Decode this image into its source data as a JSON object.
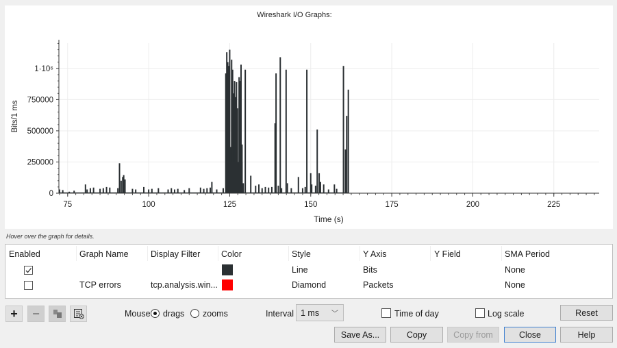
{
  "chart_data": {
    "type": "bar",
    "title": "Wireshark I/O Graphs:",
    "xlabel": "Time (s)",
    "ylabel": "Bits/1 ms",
    "xlim": [
      72.3,
      239
    ],
    "ylim": [
      0,
      1230000
    ],
    "x_ticks": [
      75,
      100,
      125,
      150,
      175,
      200,
      225
    ],
    "x_tick_labels": [
      "75",
      "100",
      "125",
      "150",
      "175",
      "200",
      "225"
    ],
    "y_ticks": [
      0,
      250000,
      500000,
      750000,
      1000000
    ],
    "y_tick_labels": [
      "0",
      "250000",
      "500000",
      "750000",
      "1·10⁶"
    ],
    "grid": true,
    "series": [
      {
        "name": "",
        "color": "#2b3033",
        "spikes": [
          [
            72.5,
            30000
          ],
          [
            73.5,
            25000
          ],
          [
            75.5,
            12000
          ],
          [
            77,
            20000
          ],
          [
            80.5,
            70000
          ],
          [
            81,
            30000
          ],
          [
            82,
            40000
          ],
          [
            83,
            45000
          ],
          [
            85,
            35000
          ],
          [
            86,
            40000
          ],
          [
            87,
            50000
          ],
          [
            88,
            45000
          ],
          [
            90.5,
            40000
          ],
          [
            91,
            240000
          ],
          [
            91.5,
            100000
          ],
          [
            92,
            130000
          ],
          [
            92.3,
            145000
          ],
          [
            92.7,
            110000
          ],
          [
            95,
            35000
          ],
          [
            96,
            30000
          ],
          [
            98.5,
            50000
          ],
          [
            100,
            30000
          ],
          [
            101,
            35000
          ],
          [
            103,
            40000
          ],
          [
            106,
            30000
          ],
          [
            107,
            40000
          ],
          [
            108,
            30000
          ],
          [
            109,
            35000
          ],
          [
            111,
            25000
          ],
          [
            112.5,
            40000
          ],
          [
            116,
            45000
          ],
          [
            117,
            35000
          ],
          [
            118,
            40000
          ],
          [
            119,
            45000
          ],
          [
            119.5,
            90000
          ],
          [
            121,
            30000
          ],
          [
            123,
            40000
          ],
          [
            123.8,
            960000
          ],
          [
            124.1,
            1130000
          ],
          [
            124.4,
            1050000
          ],
          [
            124.7,
            1020000
          ],
          [
            125,
            1150000
          ],
          [
            125.3,
            370000
          ],
          [
            125.6,
            1070000
          ],
          [
            125.9,
            990000
          ],
          [
            126.2,
            800000
          ],
          [
            126.5,
            900000
          ],
          [
            126.8,
            770000
          ],
          [
            127.1,
            890000
          ],
          [
            127.4,
            680000
          ],
          [
            127.7,
            170000
          ],
          [
            127.9,
            930000
          ],
          [
            128.2,
            900000
          ],
          [
            128.5,
            1030000
          ],
          [
            128.8,
            390000
          ],
          [
            129.2,
            80000
          ],
          [
            129.8,
            990000
          ],
          [
            131.5,
            140000
          ],
          [
            133,
            60000
          ],
          [
            134,
            70000
          ],
          [
            135,
            40000
          ],
          [
            136,
            50000
          ],
          [
            137,
            45000
          ],
          [
            138,
            50000
          ],
          [
            139,
            560000
          ],
          [
            139.3,
            960000
          ],
          [
            140,
            60000
          ],
          [
            140.6,
            1090000
          ],
          [
            141,
            40000
          ],
          [
            142.4,
            990000
          ],
          [
            142.8,
            80000
          ],
          [
            144,
            40000
          ],
          [
            146.2,
            130000
          ],
          [
            147.5,
            40000
          ],
          [
            148.3,
            50000
          ],
          [
            148.8,
            990000
          ],
          [
            150,
            160000
          ],
          [
            150.3,
            70000
          ],
          [
            151.5,
            60000
          ],
          [
            152,
            510000
          ],
          [
            152.6,
            160000
          ],
          [
            153,
            90000
          ],
          [
            154,
            70000
          ],
          [
            155.5,
            30000
          ],
          [
            157.3,
            70000
          ],
          [
            158,
            35000
          ],
          [
            160.1,
            1020000
          ],
          [
            160.7,
            350000
          ],
          [
            161.1,
            620000
          ],
          [
            161.6,
            830000
          ]
        ]
      }
    ]
  },
  "hint": "Hover over the graph for details.",
  "table": {
    "headers": [
      "Enabled",
      "Graph Name",
      "Display Filter",
      "Color",
      "Style",
      "Y Axis",
      "Y Field",
      "SMA Period"
    ],
    "rows": [
      {
        "enabled": true,
        "name": "",
        "filter": "",
        "color": "#2b3033",
        "style": "Line",
        "y_axis": "Bits",
        "y_field": "",
        "sma": "None"
      },
      {
        "enabled": false,
        "name": "TCP errors",
        "filter": "tcp.analysis.win...",
        "color": "#ff0000",
        "style": "Diamond",
        "y_axis": "Packets",
        "y_field": "",
        "sma": "None"
      }
    ]
  },
  "controls": {
    "mouse_label": "Mouse",
    "drags_label": "drags",
    "zooms_label": "zooms",
    "mouse_mode": "drags",
    "interval_label": "Interval",
    "interval_value": "1 ms",
    "time_of_day_label": "Time of day",
    "time_of_day": false,
    "log_scale_label": "Log scale",
    "log_scale": false,
    "reset": "Reset"
  },
  "buttons": {
    "save_as": "Save As...",
    "copy": "Copy",
    "copy_from": "Copy from",
    "close": "Close",
    "help": "Help"
  }
}
